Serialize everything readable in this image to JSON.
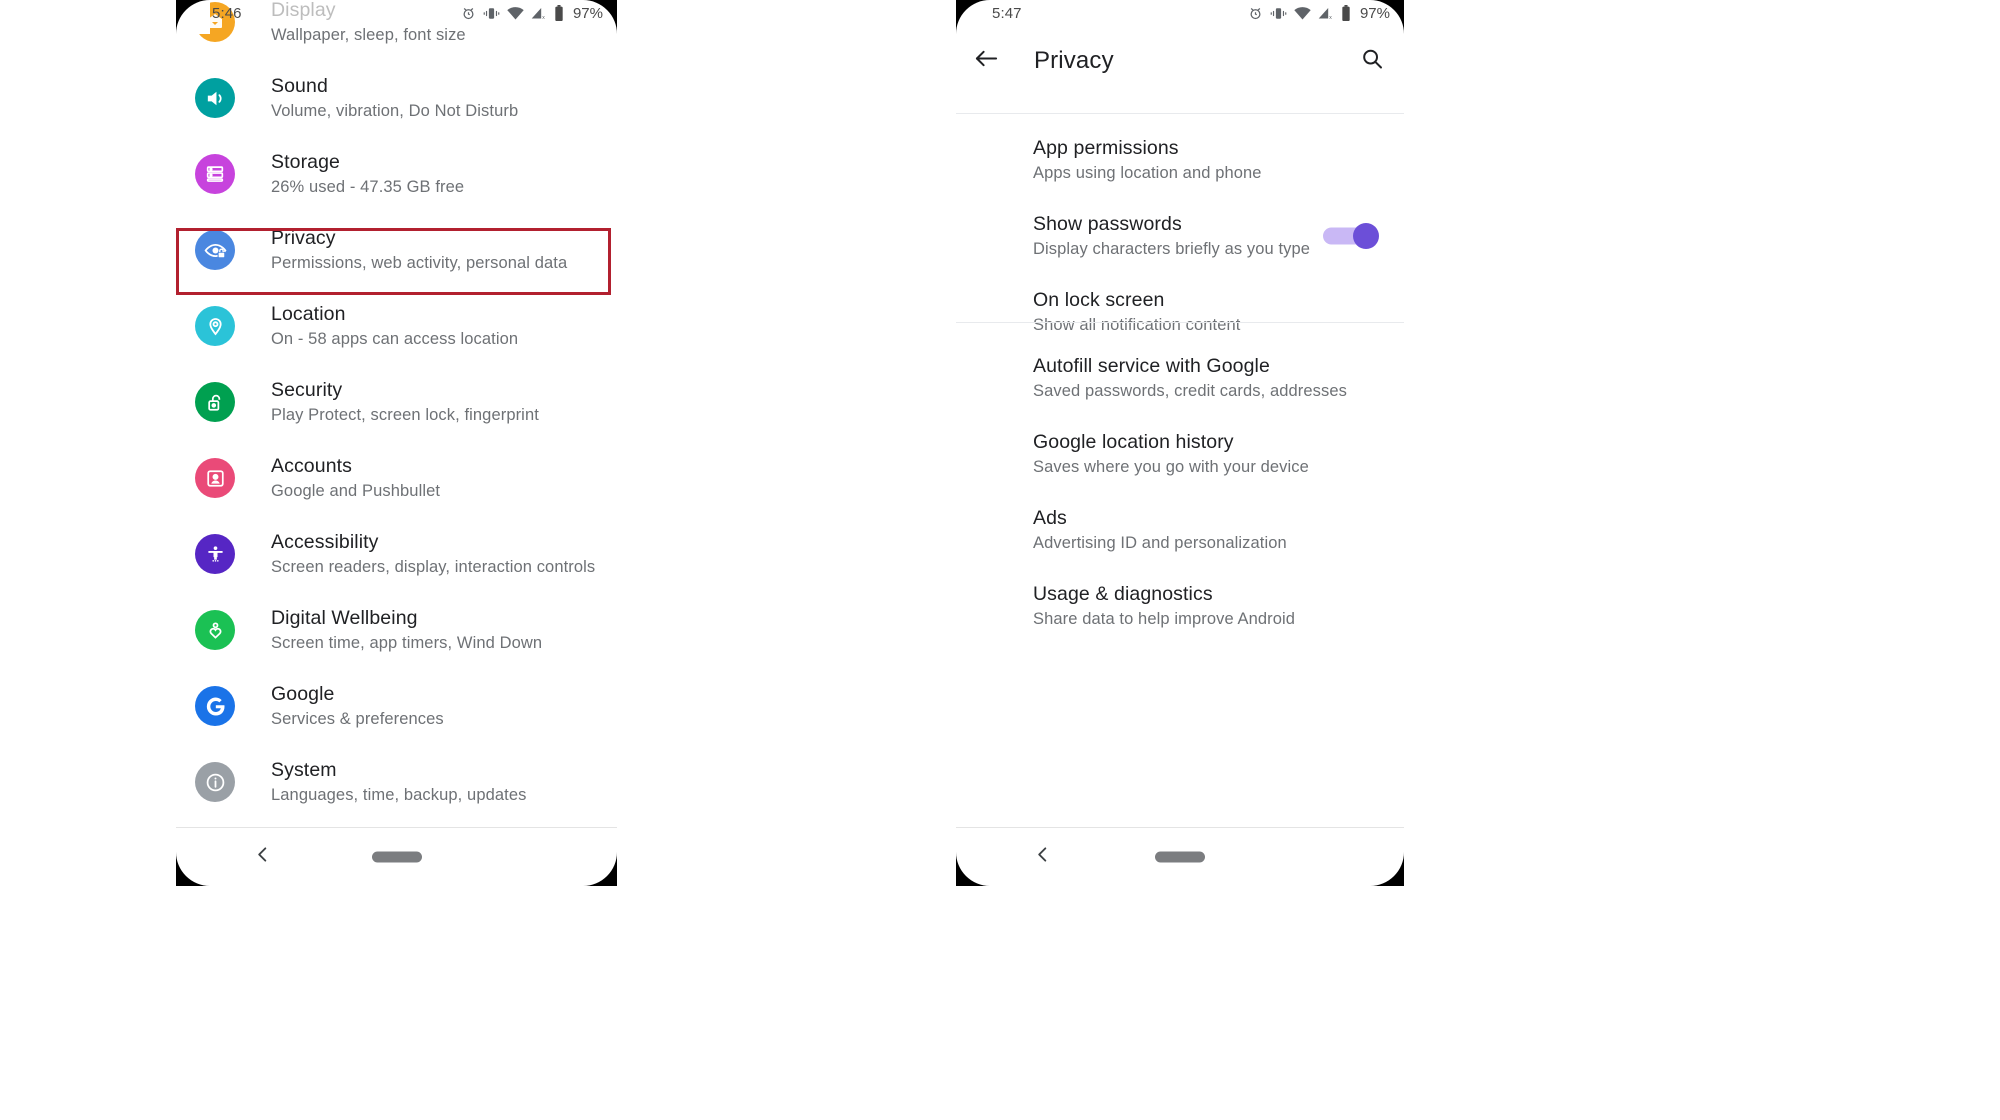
{
  "left_phone": {
    "status_bar": {
      "time": "5:46",
      "battery_percent": "97%",
      "icons": [
        "alarm-icon",
        "vibrate-icon",
        "wifi-icon",
        "cell-signal-off-icon",
        "battery-icon"
      ]
    },
    "screen_name": "Settings",
    "items": [
      {
        "title": "Display",
        "subtitle": "Wallpaper, sleep, font size",
        "icon": "display-icon",
        "icon_color": "#f5a623",
        "highlighted": false,
        "cut_off": true
      },
      {
        "title": "Sound",
        "subtitle": "Volume, vibration, Do Not Disturb",
        "icon": "sound-icon",
        "icon_color": "#00a0a0",
        "highlighted": false
      },
      {
        "title": "Storage",
        "subtitle": "26% used - 47.35 GB free",
        "icon": "storage-icon",
        "icon_color": "#c743dd",
        "highlighted": false
      },
      {
        "title": "Privacy",
        "subtitle": "Permissions, web activity, personal data",
        "icon": "privacy-eye-lock-icon",
        "icon_color": "#4a87e0",
        "highlighted": true
      },
      {
        "title": "Location",
        "subtitle": "On - 58 apps can access location",
        "icon": "location-pin-icon",
        "icon_color": "#2bc3d8",
        "highlighted": false
      },
      {
        "title": "Security",
        "subtitle": "Play Protect, screen lock, fingerprint",
        "icon": "security-unlock-icon",
        "icon_color": "#00a050",
        "highlighted": false
      },
      {
        "title": "Accounts",
        "subtitle": "Google and Pushbullet",
        "icon": "accounts-person-icon",
        "icon_color": "#ea4a78",
        "highlighted": false
      },
      {
        "title": "Accessibility",
        "subtitle": "Screen readers, display, interaction controls",
        "icon": "accessibility-icon",
        "icon_color": "#5626c4",
        "highlighted": false
      },
      {
        "title": "Digital Wellbeing",
        "subtitle": "Screen time, app timers, Wind Down",
        "icon": "digital-wellbeing-icon",
        "icon_color": "#1bc154",
        "highlighted": false
      },
      {
        "title": "Google",
        "subtitle": "Services & preferences",
        "icon": "google-g-icon",
        "icon_color": "#1a73e8",
        "highlighted": false
      },
      {
        "title": "System",
        "subtitle": "Languages, time, backup, updates",
        "icon": "system-info-icon",
        "icon_color": "#9aa0a6",
        "highlighted": false
      }
    ],
    "nav_bar": {
      "back": "back-chevron-icon",
      "home_pill": "home-pill-icon"
    }
  },
  "right_phone": {
    "status_bar": {
      "time": "5:47",
      "battery_percent": "97%",
      "icons": [
        "alarm-icon",
        "vibrate-icon",
        "wifi-icon",
        "cell-signal-off-icon",
        "battery-icon"
      ]
    },
    "app_bar": {
      "title": "Privacy",
      "back_icon": "arrow-back-icon",
      "search_icon": "search-icon"
    },
    "group_one": [
      {
        "title": "App permissions",
        "subtitle": "Apps using location and phone",
        "control": "none"
      },
      {
        "title": "Show passwords",
        "subtitle": "Display characters briefly as you type",
        "control": "toggle",
        "toggle_on": true,
        "toggle_color": "#6c4fd8"
      },
      {
        "title": "On lock screen",
        "subtitle": "Show all notification content",
        "control": "none"
      }
    ],
    "group_two": [
      {
        "title": "Autofill service with Google",
        "subtitle": "Saved passwords, credit cards, addresses",
        "control": "none"
      },
      {
        "title": "Google location history",
        "subtitle": "Saves where you go with your device",
        "control": "none"
      },
      {
        "title": "Ads",
        "subtitle": "Advertising ID and personalization",
        "control": "none"
      },
      {
        "title": "Usage & diagnostics",
        "subtitle": "Share data to help improve Android",
        "control": "none"
      }
    ],
    "nav_bar": {
      "back": "back-chevron-icon",
      "home_pill": "home-pill-icon"
    }
  },
  "annotation": {
    "highlight_color": "#b2202f",
    "highlight_target": "Privacy"
  }
}
